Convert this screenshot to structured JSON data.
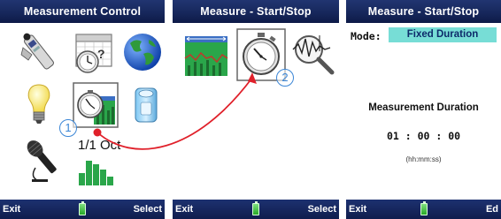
{
  "screens": [
    {
      "title": "Measurement Control",
      "softkeys": {
        "left": "Exit",
        "right": "Select"
      },
      "icons": [
        "sound-level-meter-icon",
        "calendar-timer-icon",
        "globe-icon",
        "light-bulb-icon",
        "measure-start-stop-icon",
        "sound-calibrator-icon",
        "microphone-icon",
        "octave-band-icon"
      ],
      "octave_label": "1/1 Oct",
      "callout": "1"
    },
    {
      "title": "Measure - Start/Stop",
      "softkeys": {
        "left": "Exit",
        "right": "Select"
      },
      "icons": [
        "level-history-icon",
        "stopwatch-icon",
        "trigger-icon"
      ],
      "callout": "2"
    },
    {
      "title": "Measure - Start/Stop",
      "softkeys": {
        "left": "Exit",
        "right": "Ed"
      },
      "mode_label": "Mode:",
      "mode_value": "Fixed Duration",
      "duration_title": "Measurement Duration",
      "duration_value": "01 : 00 : 00",
      "duration_format": "(hh:mm:ss)"
    }
  ],
  "colors": {
    "titlebar": "#16265a",
    "selection": "#77ddd6",
    "callout": "#3b86d6",
    "arrow": "#e0202a"
  }
}
